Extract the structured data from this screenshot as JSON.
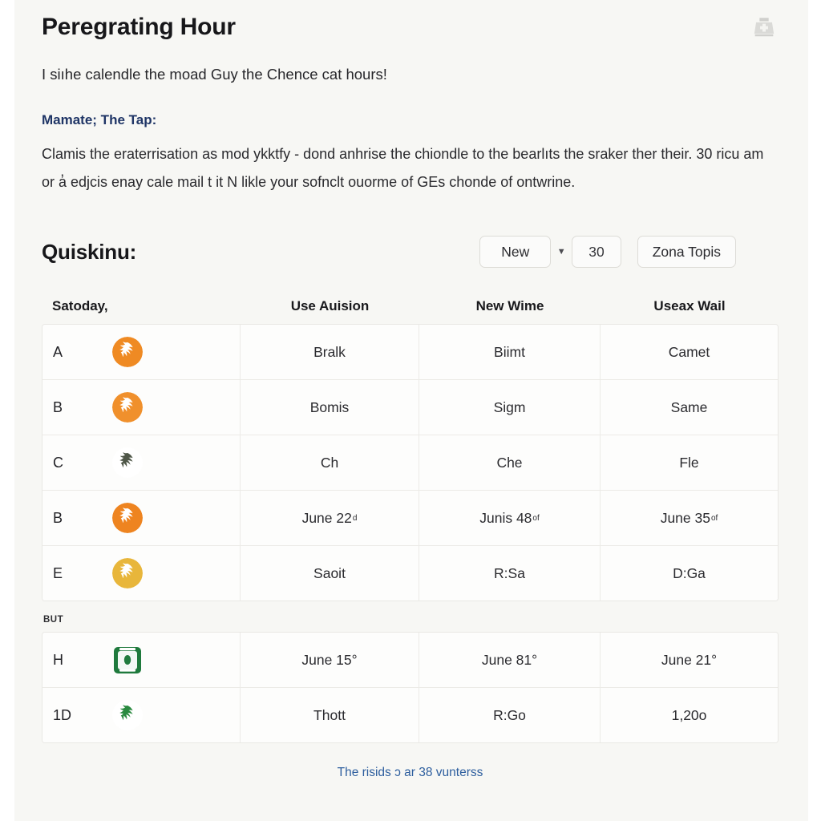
{
  "header": {
    "title": "Peregrating Hour",
    "subtitle": "I siıhe calendle the moad Guy the Chence cat hours!",
    "crest_icon": "institution-crest-icon"
  },
  "note": {
    "heading": "Mamate; The Tap:",
    "body": "Clamis the eraterrisation as mod ykktfy - dond anhrise the chiondle to the bearlıts the sraker ther their. 30 ricu am or a̓ edjcis enay cale mail t it N likle your sofnclt ouorme of GEs chonde of ontwrine."
  },
  "section": {
    "title": "Quiskinu:",
    "toolbar": {
      "new_label": "New",
      "caret_icon": "chevron-down-icon",
      "count_label": "30",
      "topis_label": "Zona Topis"
    }
  },
  "table": {
    "columns": [
      "Satoday,",
      "Use Auision",
      "New Wime",
      "Useax Wail"
    ],
    "group_label": "But",
    "rows_primary": [
      {
        "label": "A",
        "avatar": {
          "name": "orange-creature-avatar",
          "shape": "circle",
          "bg": "#ef8a23",
          "fg": "#ffffff"
        },
        "c2": "Bralk",
        "c2_sup": "",
        "c3": "Biimt",
        "c3_sup": "",
        "c4": "Camet",
        "c4_sup": ""
      },
      {
        "label": "B",
        "avatar": {
          "name": "orange-swirl-avatar",
          "shape": "circle",
          "bg": "#f0902c",
          "fg": "#ffffff"
        },
        "c2": "Bomis",
        "c2_sup": "",
        "c3": "Sigm",
        "c3_sup": "",
        "c4": "Same",
        "c4_sup": ""
      },
      {
        "label": "C",
        "avatar": {
          "name": "olive-crest-avatar",
          "shape": "circle",
          "bg": "#ffffff",
          "fg": "#4e5647"
        },
        "c2": "Ch",
        "c2_sup": "",
        "c3": "Che",
        "c3_sup": "",
        "c4": "Fle",
        "c4_sup": ""
      },
      {
        "label": "B",
        "avatar": {
          "name": "orange-animal-avatar",
          "shape": "circle",
          "bg": "#ee8420",
          "fg": "#ffffff"
        },
        "c2": "June 22",
        "c2_sup": "d",
        "c3": "Junis 48",
        "c3_sup": "of",
        "c4": "June 35",
        "c4_sup": "of"
      },
      {
        "label": "E",
        "avatar": {
          "name": "gold-bird-avatar",
          "shape": "circle",
          "bg": "#e8b63b",
          "fg": "#ffffff"
        },
        "c2": "Saoit",
        "c2_sup": "",
        "c3": "R:Sa",
        "c3_sup": "",
        "c4": "D:Ga",
        "c4_sup": ""
      }
    ],
    "rows_secondary": [
      {
        "label": "H",
        "avatar": {
          "name": "green-shield-badge-icon",
          "shape": "square",
          "bg": "#1f7a3d",
          "fg": "#ffffff"
        },
        "c2": "June 15°",
        "c2_sup": "",
        "c3": "June 81°",
        "c3_sup": "",
        "c4": "June 21°",
        "c4_sup": ""
      },
      {
        "label": "1D",
        "avatar": {
          "name": "green-tree-avatar",
          "shape": "circle",
          "bg": "#ffffff",
          "fg": "#2a8a40"
        },
        "c2": "Thott",
        "c2_sup": "",
        "c3": "R:Go",
        "c3_sup": "",
        "c4": "1,20o",
        "c4_sup": ""
      }
    ]
  },
  "footer": {
    "link_text": "The risids ɔ ar 38 vunterss"
  },
  "colors": {
    "panel_bg": "#f7f7f4",
    "cell_bg": "#fdfdfc",
    "border": "#ecebe7",
    "link": "#2d5e9e",
    "note_heading": "#1f3566"
  }
}
